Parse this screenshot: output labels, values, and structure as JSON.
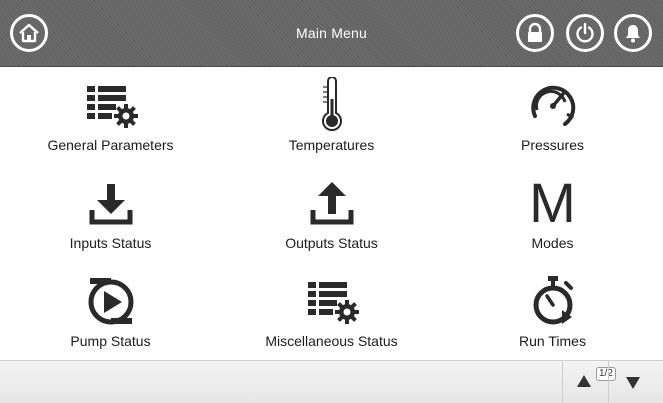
{
  "header": {
    "title": "Main Menu",
    "icons": [
      "home-icon",
      "lock-icon",
      "power-icon",
      "bell-icon"
    ]
  },
  "menu": {
    "items": [
      {
        "label": "General Parameters",
        "icon": "settings-list-icon"
      },
      {
        "label": "Temperatures",
        "icon": "thermometer-icon"
      },
      {
        "label": "Pressures",
        "icon": "gauge-icon"
      },
      {
        "label": "Inputs Status",
        "icon": "download-icon"
      },
      {
        "label": "Outputs Status",
        "icon": "upload-icon"
      },
      {
        "label": "Modes",
        "icon": "modes-m-icon",
        "glyph": "M"
      },
      {
        "label": "Pump Status",
        "icon": "pump-icon"
      },
      {
        "label": "Miscellaneous Status",
        "icon": "settings-list-icon"
      },
      {
        "label": "Run Times",
        "icon": "stopwatch-icon"
      }
    ]
  },
  "footer": {
    "page_indicator": "1/2"
  },
  "colors": {
    "header_bg": "#6a6a6a",
    "icon_fill": "#2a2a2a"
  }
}
